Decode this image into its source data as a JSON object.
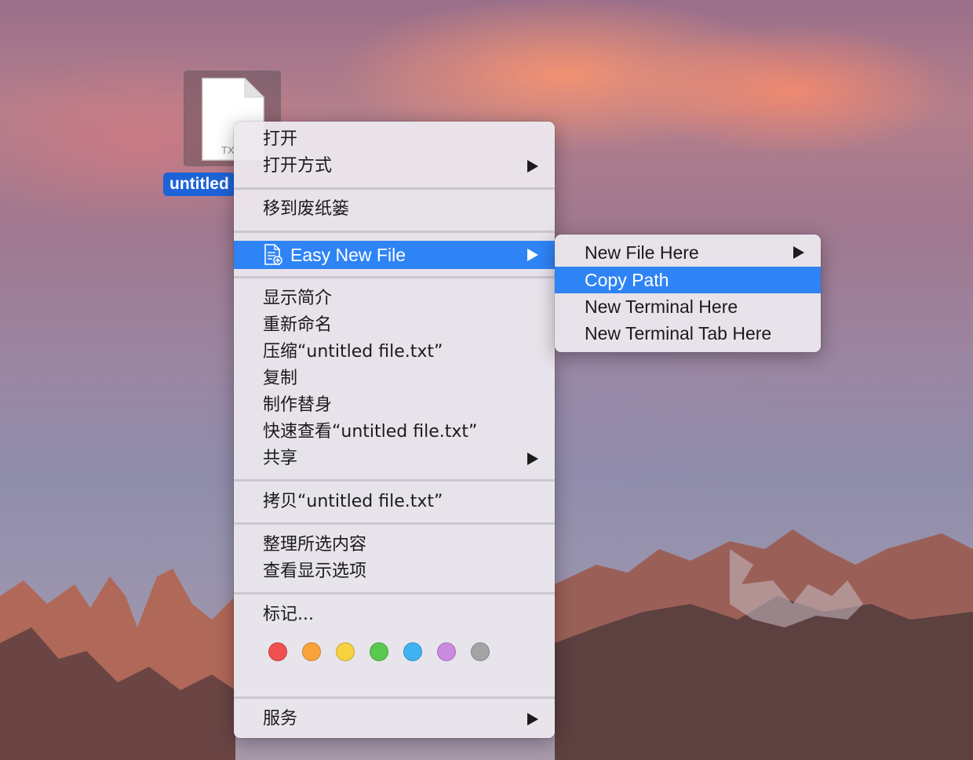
{
  "desktop": {
    "file": {
      "ext_label": "TX",
      "name_label": "untitled"
    }
  },
  "context_menu": {
    "groups": [
      [
        "打开",
        "打开方式"
      ],
      [
        "移到废纸篓"
      ],
      [
        "Easy New File"
      ],
      [
        "显示简介",
        "重新命名",
        "压缩“untitled file.txt”",
        "复制",
        "制作替身",
        "快速查看“untitled file.txt”",
        "共享"
      ],
      [
        "拷贝“untitled file.txt”"
      ],
      [
        "整理所选内容",
        "查看显示选项"
      ],
      [
        "标记..."
      ],
      [
        "服务"
      ]
    ],
    "open": "打开",
    "open_with": "打开方式",
    "move_to_trash": "移到废纸篓",
    "easy_new_file": "Easy New File",
    "get_info": "显示简介",
    "rename": "重新命名",
    "compress": "压缩“untitled file.txt”",
    "duplicate": "复制",
    "make_alias": "制作替身",
    "quick_look": "快速查看“untitled file.txt”",
    "share": "共享",
    "copy_file": "拷贝“untitled file.txt”",
    "clean_up": "整理所选内容",
    "view_options": "查看显示选项",
    "tags_label": "标记...",
    "tag_colors": [
      "#f05050",
      "#f9a23a",
      "#f7d13e",
      "#5ac94f",
      "#3fb3f2",
      "#c98ae0",
      "#a4a4a4"
    ],
    "services": "服务",
    "highlight_color": "#2f84f5"
  },
  "submenu": {
    "new_file_here": "New File Here",
    "copy_path": "Copy Path",
    "new_terminal_here": "New Terminal Here",
    "new_terminal_tab_here": "New Terminal Tab Here"
  }
}
